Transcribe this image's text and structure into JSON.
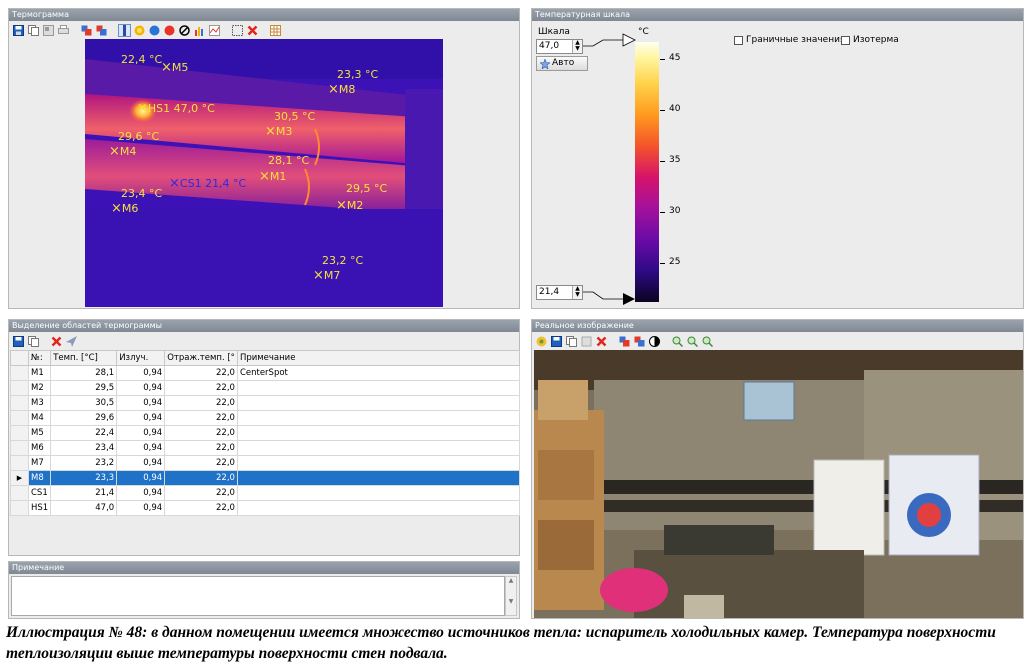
{
  "thermo": {
    "title": "Термограмма",
    "markers": [
      {
        "id": "M5",
        "label": "M5",
        "temp": "22,4 °C"
      },
      {
        "id": "M8",
        "label": "M8",
        "temp": "23,3 °C"
      },
      {
        "id": "HS1",
        "label": "HS1 47,0 °C",
        "temp": ""
      },
      {
        "id": "M3",
        "label": "M3",
        "temp": "30,5 °C"
      },
      {
        "id": "M4",
        "label": "M4",
        "temp": "29,6 °C"
      },
      {
        "id": "M1",
        "label": "M1",
        "temp": "28,1 °C"
      },
      {
        "id": "M2",
        "label": "M2",
        "temp": "29,5 °C"
      },
      {
        "id": "M6",
        "label": "M6",
        "temp": "23,4 °C"
      },
      {
        "id": "CS1",
        "label": "CS1 21,4 °C",
        "temp": ""
      },
      {
        "id": "M7",
        "label": "M7",
        "temp": "23,2 °C"
      }
    ]
  },
  "scale": {
    "title": "Температурная шкала",
    "label": "Шкала",
    "max_value": "47,0",
    "min_value": "21,4",
    "auto_label": "Авто",
    "unit": "°C",
    "ticks": [
      "45",
      "40",
      "35",
      "30",
      "25"
    ],
    "checkbox_limits": "Граничные значения",
    "checkbox_isotherm": "Изотерма"
  },
  "table": {
    "title": "Выделение областей термограммы",
    "columns": [
      "№:",
      "Темп. [°C]",
      "Излуч.",
      "Отраж.темп. [°",
      "Примечание"
    ],
    "rows": [
      {
        "name": "M1",
        "temp": "28,1",
        "emis": "0,94",
        "refl": "22,0",
        "note": "CenterSpot",
        "selected": false
      },
      {
        "name": "M2",
        "temp": "29,5",
        "emis": "0,94",
        "refl": "22,0",
        "note": "",
        "selected": false
      },
      {
        "name": "M3",
        "temp": "30,5",
        "emis": "0,94",
        "refl": "22,0",
        "note": "",
        "selected": false
      },
      {
        "name": "M4",
        "temp": "29,6",
        "emis": "0,94",
        "refl": "22,0",
        "note": "",
        "selected": false
      },
      {
        "name": "M5",
        "temp": "22,4",
        "emis": "0,94",
        "refl": "22,0",
        "note": "",
        "selected": false
      },
      {
        "name": "M6",
        "temp": "23,4",
        "emis": "0,94",
        "refl": "22,0",
        "note": "",
        "selected": false
      },
      {
        "name": "M7",
        "temp": "23,2",
        "emis": "0,94",
        "refl": "22,0",
        "note": "",
        "selected": false
      },
      {
        "name": "M8",
        "temp": "23,3",
        "emis": "0,94",
        "refl": "22,0",
        "note": "",
        "selected": true
      },
      {
        "name": "CS1",
        "temp": "21,4",
        "emis": "0,94",
        "refl": "22,0",
        "note": "",
        "selected": false
      },
      {
        "name": "HS1",
        "temp": "47,0",
        "emis": "0,94",
        "refl": "22,0",
        "note": "",
        "selected": false
      }
    ]
  },
  "note": {
    "title": "Примечание"
  },
  "real": {
    "title": "Реальное изображение"
  },
  "caption": "Иллюстрация № 48: в данном помещении имеется множество источников тепла: испаритель холодильных камер. Температура поверхности теплоизоляции выше температуры поверхности стен подвала."
}
